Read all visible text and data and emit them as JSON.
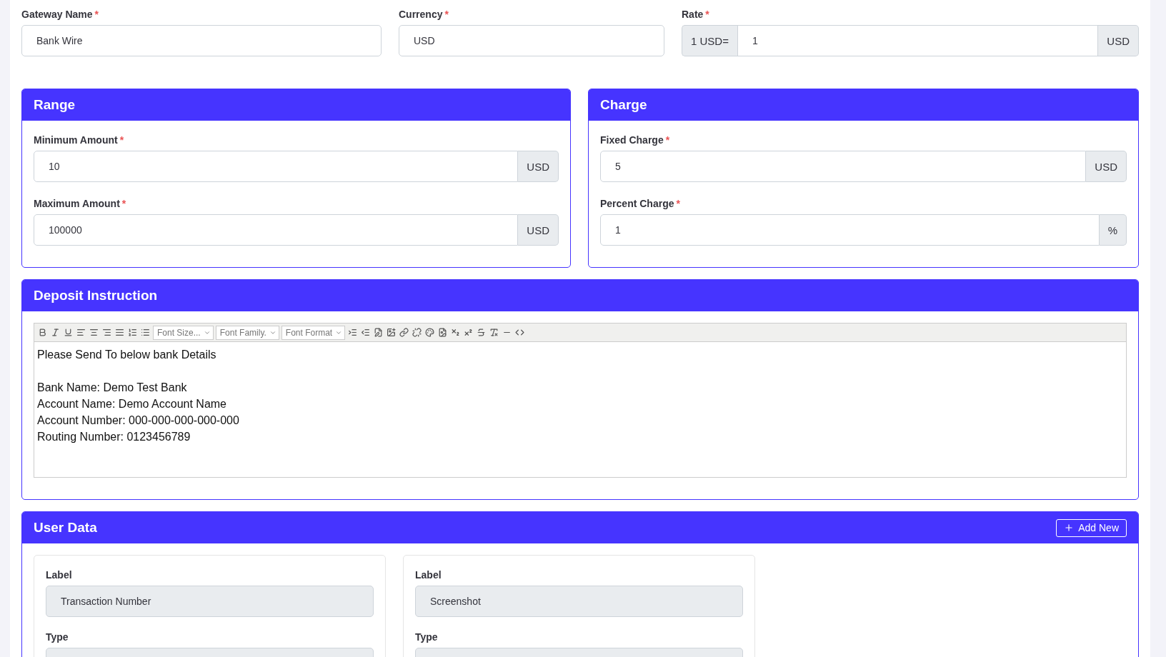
{
  "top_fields": [
    {
      "label": "Gateway Name",
      "mark": "*",
      "kind": "text",
      "value": "Bank Wire"
    },
    {
      "label": "Currency",
      "mark": "*",
      "kind": "text",
      "value": "USD"
    },
    {
      "label": "Rate",
      "mark": "*",
      "kind": "group",
      "prefix": "1 USD=",
      "value": "1",
      "suffix": "USD"
    }
  ],
  "sections": [
    {
      "title": "Range",
      "fields": [
        {
          "label": "Minimum Amount",
          "mark": "*",
          "value": "10",
          "suffix": "USD"
        },
        {
          "label": "Maximum Amount",
          "mark": "*",
          "value": "100000",
          "suffix": "USD"
        }
      ]
    },
    {
      "title": "Charge",
      "fields": [
        {
          "label": "Fixed Charge",
          "mark": "*",
          "value": "5",
          "suffix": "USD"
        },
        {
          "label": "Percent Charge",
          "mark": "*",
          "value": "1",
          "suffix": "%"
        }
      ]
    }
  ],
  "deposit_instruction": {
    "title": "Deposit Instruction",
    "selects": [
      "Font Size...",
      "Font Family.",
      "Font Format"
    ],
    "paragraphs": [
      [
        "Please Send To below bank Details"
      ],
      [
        "Bank Name: Demo Test Bank",
        "Account Name: Demo Account Name",
        "Account Number: 000-000-000-000-000",
        "Routing Number: 0123456789"
      ]
    ]
  },
  "user_data": {
    "title": "User Data",
    "add_button": "Add New",
    "items": [
      {
        "label_caption": "Label",
        "label_value": "Transaction Number",
        "type_caption": "Type"
      },
      {
        "label_caption": "Label",
        "label_value": "Screenshot",
        "type_caption": "Type"
      }
    ]
  }
}
